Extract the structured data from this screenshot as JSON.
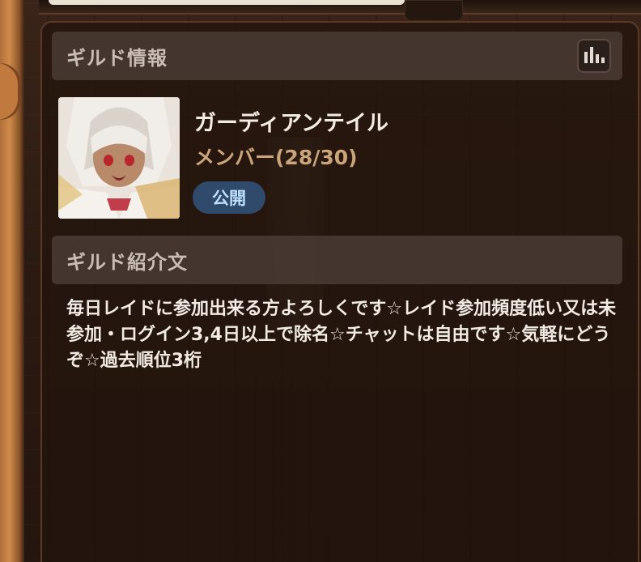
{
  "panel": {
    "guild_info_title": "ギルド情報",
    "stats_icon": "bar-chart-icon"
  },
  "guild": {
    "name": "ガーディアンテイル",
    "members": "メンバー(28/30)",
    "visibility": "公開",
    "avatar_icon": "guild-emblem-anime-character"
  },
  "intro": {
    "title": "ギルド紹介文",
    "text": "毎日レイドに参加出来る方よろしくです☆レイド参加頻度低い又は未参加・ログイン3,4日以上で除名☆チャットは自由です☆気軽にどうぞ☆過去順位3桁"
  },
  "colors": {
    "header_bg": "#483832",
    "member_text": "#caa57a",
    "badge_bg": "#2f4a6a",
    "badge_text": "#bfe0ff"
  }
}
